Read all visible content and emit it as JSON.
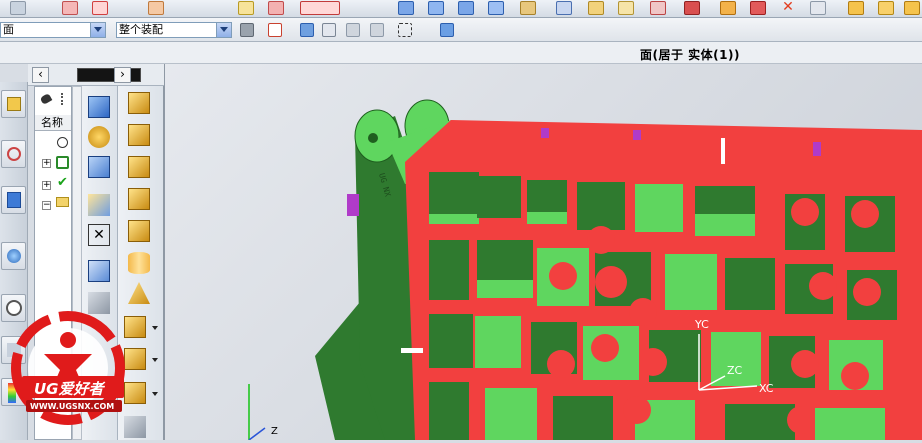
{
  "filter_bar": {
    "selection_filter": "面",
    "assembly_scope": "整个装配"
  },
  "status": {
    "selection_info": "面(居于 实体(1))"
  },
  "navigator": {
    "column_name": "名称"
  },
  "viewport": {
    "wcs_labels": {
      "yc": "YC",
      "zc": "ZC",
      "xc": "XC"
    },
    "absolute_axis_labels": {
      "z": "Z"
    },
    "part_engraving": "UG NX"
  },
  "watermark": {
    "brand": "UG爱好者",
    "url": "WWW.UGSNX.COM"
  },
  "colors": {
    "face_highlight": "#f2403f",
    "part_green": "#5fd65f",
    "part_dark_green": "#2f7a2f",
    "violet_slot": "#b03bc9",
    "watermark_red": "#e01b1b"
  }
}
